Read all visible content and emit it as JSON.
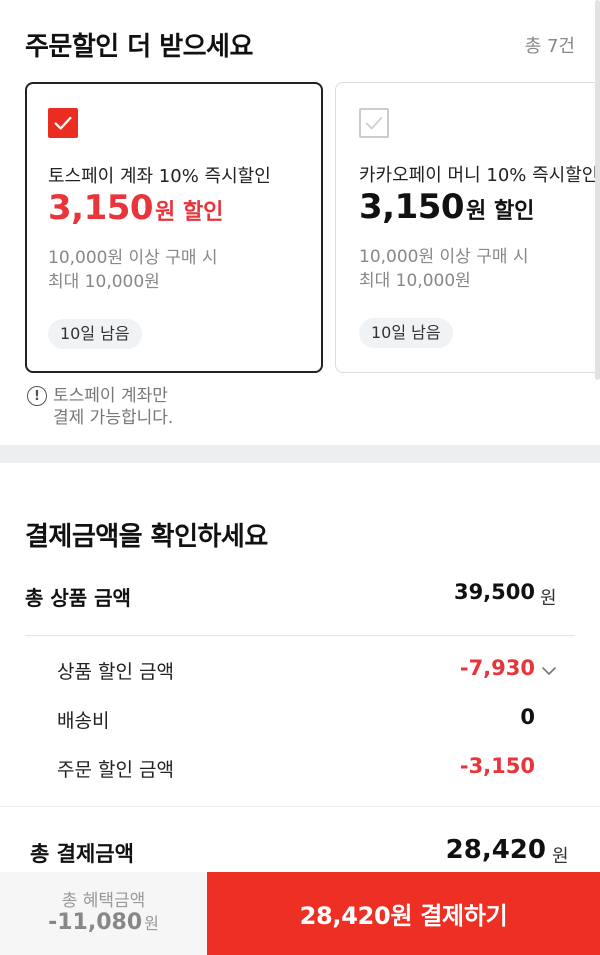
{
  "coupons": {
    "title": "주문할인 더 받으세요",
    "count": "총 7건",
    "cards": [
      {
        "name": "토스페이 계좌 10% 즉시할인",
        "amount": "3,150",
        "amount_unit": "원 할인",
        "condition_1": "10,000원 이상 구매 시",
        "condition_2": "최대 10,000원",
        "badge": "10일 남음",
        "selected": true
      },
      {
        "name": "카카오페이 머니 10% 즉시할인",
        "amount": "3,150",
        "amount_unit": "원 할인",
        "condition_1": "10,000원 이상 구매 시",
        "condition_2": "최대 10,000원",
        "badge": "10일 남음",
        "selected": false
      }
    ],
    "notice_icon": "!",
    "notice_line1": "토스페이 계좌만",
    "notice_line2": "결제 가능합니다."
  },
  "payment": {
    "title": "결제금액을 확인하세요",
    "total_label": "총 상품 금액",
    "total_value": "39,500",
    "won": "원",
    "product_discount_label": "상품 할인 금액",
    "product_discount_value": "-7,930",
    "shipping_label": "배송비",
    "shipping_value": "0",
    "order_discount_label": "주문 할인 금액",
    "order_discount_value": "-3,150",
    "final_label": "총 결제금액",
    "final_value": "28,420"
  },
  "bottom_bar": {
    "benefit_label": "총 혜택금액",
    "benefit_value": "-11,080",
    "benefit_unit": "원",
    "pay_button": "28,420원 결제하기"
  },
  "colors": {
    "accent": "#ee2f24",
    "discount_red": "#e8343a",
    "badge_bg": "#f0f3f6"
  }
}
